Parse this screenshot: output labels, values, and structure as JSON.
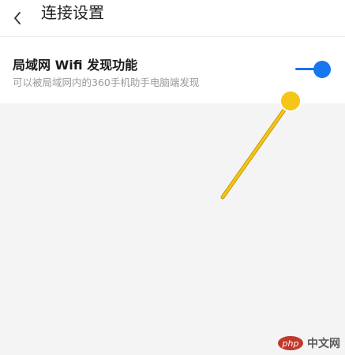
{
  "header": {
    "title": "连接设置",
    "back_icon": "chevron-left-icon"
  },
  "setting": {
    "title": "局域网 Wifi 发现功能",
    "description": "可以被局域网内的360手机助手电脑端发现",
    "toggle_on": true
  },
  "colors": {
    "accent": "#1677ee",
    "annotation": "#f5c518"
  },
  "watermark": {
    "logo_text": "php",
    "text": "中文网"
  }
}
